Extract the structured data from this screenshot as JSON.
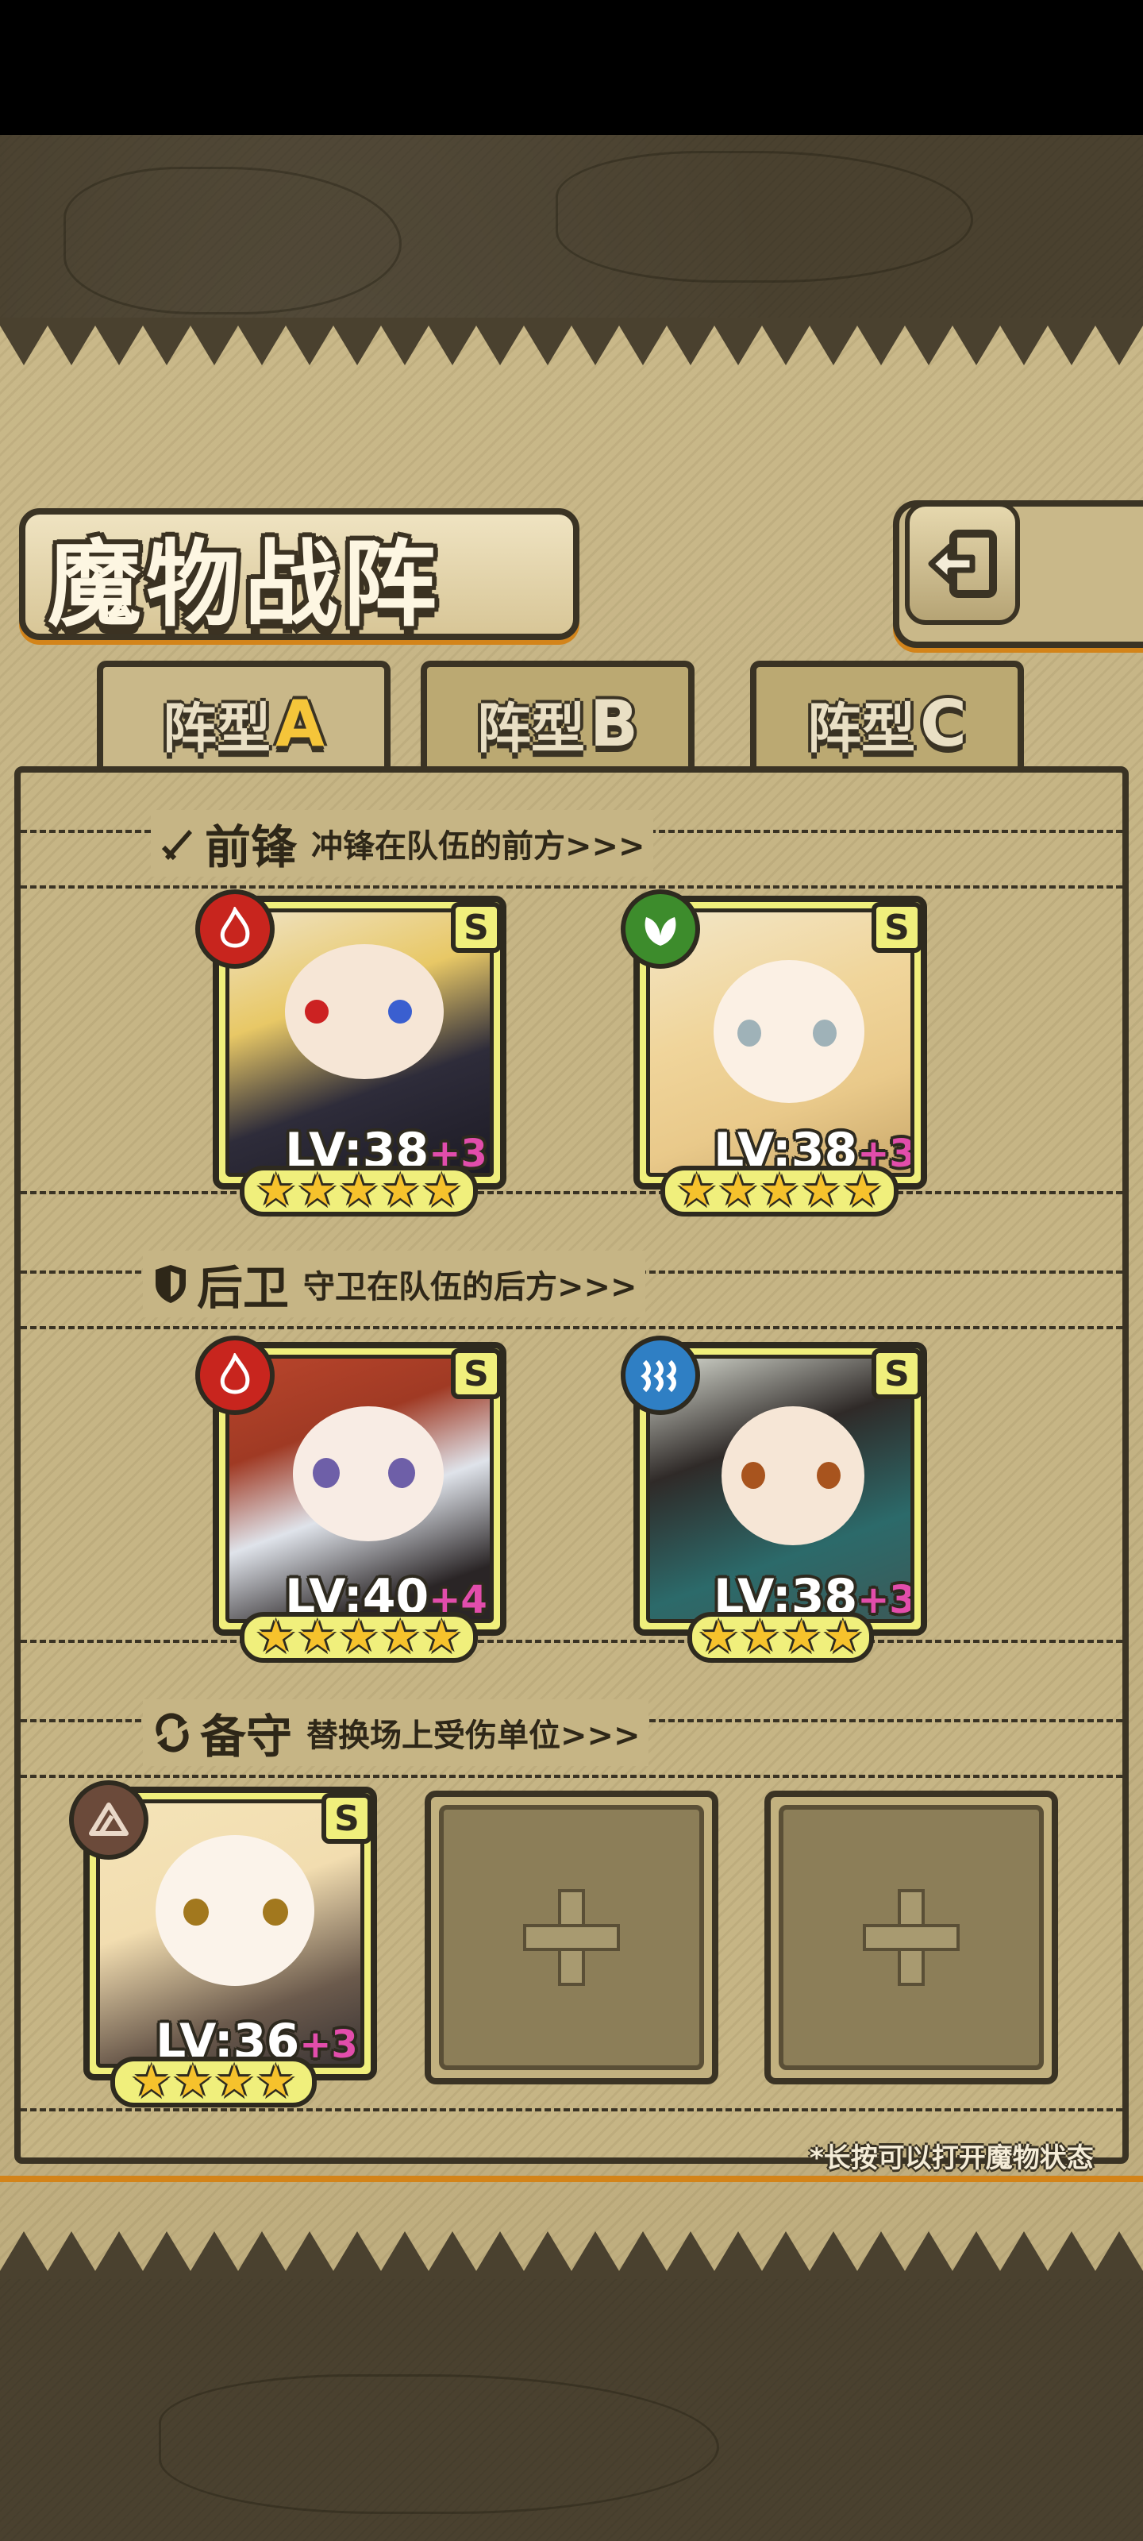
{
  "screen": {
    "title": "魔物战阵",
    "back_icon": "back-arrow-icon",
    "tabs": [
      {
        "label": "阵型",
        "letter": "A",
        "active": true
      },
      {
        "label": "阵型",
        "letter": "B",
        "active": false
      },
      {
        "label": "阵型",
        "letter": "C",
        "active": false
      }
    ],
    "sections": {
      "front": {
        "title": "前锋",
        "desc": "冲锋在队伍的前方>>>",
        "icon": "sword-icon"
      },
      "rear": {
        "title": "后卫",
        "desc": "守卫在队伍的后方>>>",
        "icon": "shield-icon"
      },
      "reserve": {
        "title": "备守",
        "desc": "替换场上受伤单位>>>",
        "icon": "swap-icon"
      }
    },
    "units": {
      "front_1": {
        "element": "fire-icon",
        "rank": "S",
        "level": "LV:38",
        "bonus": "+3",
        "stars": 5
      },
      "front_2": {
        "element": "leaf-icon",
        "rank": "S",
        "level": "LV:38",
        "bonus": "+3",
        "stars": 5
      },
      "rear_1": {
        "element": "fire-icon",
        "rank": "S",
        "level": "LV:40",
        "bonus": "+4",
        "stars": 5
      },
      "rear_2": {
        "element": "water-icon",
        "rank": "S",
        "level": "LV:38",
        "bonus": "+3",
        "stars": 4
      },
      "reserve_1": {
        "element": "earth-icon",
        "rank": "S",
        "level": "LV:36",
        "bonus": "+3",
        "stars": 4
      }
    },
    "empty_slot_icon": "plus-icon",
    "hint": "*长按可以打开魔物状态",
    "colors": {
      "fire": "#c8251e",
      "leaf": "#3d8c2c",
      "water": "#2f7fc4",
      "earth": "#6b4a3a",
      "card_frame": "#f0ef7c",
      "accent_orange": "#d3841a"
    }
  }
}
